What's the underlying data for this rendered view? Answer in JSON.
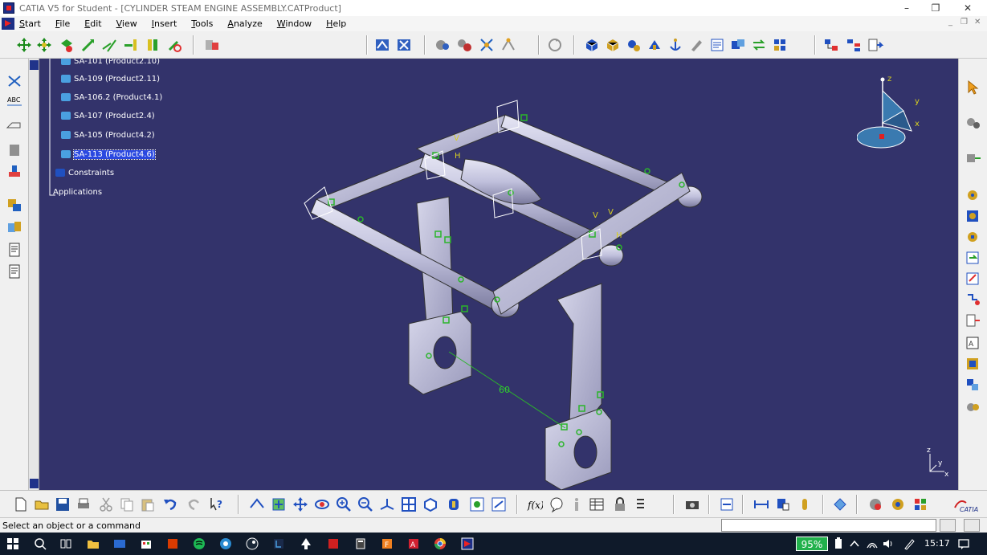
{
  "window": {
    "title": "CATIA V5 for Student - [CYLINDER STEAM ENGINE ASSEMBLY.CATProduct]",
    "minimize_glyph": "–",
    "restore_glyph": "❐",
    "close_glyph": "✕"
  },
  "menu": {
    "items": [
      "Start",
      "File",
      "Edit",
      "View",
      "Insert",
      "Tools",
      "Analyze",
      "Window",
      "Help"
    ],
    "mdi_controls": [
      "_",
      "❐",
      "✕"
    ]
  },
  "tree": {
    "rows": [
      {
        "label": "SA-101 (Product2.10)",
        "selected": false
      },
      {
        "label": "SA-109 (Product2.11)",
        "selected": false
      },
      {
        "label": "SA-106.2 (Product4.1)",
        "selected": false
      },
      {
        "label": "SA-107 (Product2.4)",
        "selected": false
      },
      {
        "label": "SA-105 (Product4.2)",
        "selected": false
      },
      {
        "label": "SA-113 (Product4.6)",
        "selected": true
      },
      {
        "label": "Constraints",
        "selected": false
      },
      {
        "label": "Applications",
        "selected": false
      }
    ]
  },
  "viewport": {
    "dimension_label": "60",
    "constraint_labels": [
      "V",
      "H",
      "V",
      "V",
      "H"
    ],
    "compass_labels": {
      "z": "z",
      "y": "y",
      "x": "x"
    },
    "axis_labels": {
      "z": "z",
      "y": "y",
      "x": "x"
    },
    "colors": {
      "background": "#33336b",
      "part": "#c9c9e4",
      "part_shade": "#8c8cae",
      "constraint": "#2bb52b",
      "dimension_text": "#2fcf2f",
      "compass_accent": "#e02020"
    }
  },
  "status": {
    "message": "Select an object or a command",
    "command_input": ""
  },
  "taskbar": {
    "battery": "95%",
    "time": "15:17",
    "colors": {
      "battery": "#22b14c"
    }
  }
}
